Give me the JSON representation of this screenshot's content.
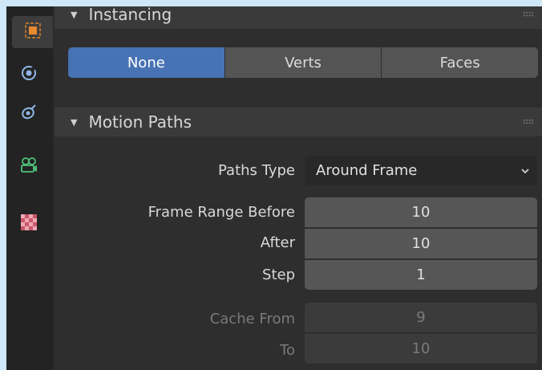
{
  "tabs": [
    {
      "icon": "object-properties-icon",
      "active": true
    },
    {
      "icon": "physics-icon",
      "active": false
    },
    {
      "icon": "constraints-icon",
      "active": false
    },
    {
      "icon": "object-data-camera-icon",
      "active": false
    },
    {
      "icon": "texture-checker-icon",
      "active": false
    }
  ],
  "instancing": {
    "title": "Instancing",
    "options": [
      "None",
      "Verts",
      "Faces"
    ],
    "selected": "None"
  },
  "motion_paths": {
    "title": "Motion Paths",
    "paths_type_label": "Paths Type",
    "paths_type_value": "Around Frame",
    "frame_range_before_label": "Frame Range Before",
    "frame_range_before_value": "10",
    "after_label": "After",
    "after_value": "10",
    "step_label": "Step",
    "step_value": "1",
    "cache_from_label": "Cache From",
    "cache_from_value": "9",
    "to_label": "To",
    "to_value": "10"
  },
  "colors": {
    "accent": "#4772b3",
    "panel_bg": "#2e2e2e",
    "header_bg": "#3a3a3a",
    "field_bg": "#565656"
  }
}
